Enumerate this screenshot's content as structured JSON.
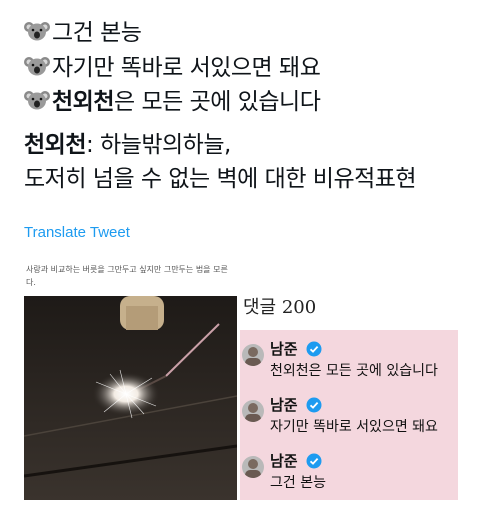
{
  "tweet": {
    "lines": [
      {
        "icon": "koala-emoji",
        "text": "그건 본능"
      },
      {
        "icon": "koala-emoji",
        "text": "자기만 똑바로 서있으면 돼요"
      },
      {
        "icon": "koala-emoji",
        "bold": "천외천",
        "text": "은 모든 곳에 있습니다"
      }
    ],
    "definition": {
      "term": "천외천",
      "line1": ": 하늘밖의하늘,",
      "line2": "도저히 넘을 수 없는 벽에 대한 비유적표현"
    },
    "translate_label": "Translate Tweet"
  },
  "image": {
    "caption": "사랑과 비교하는 버릇을 그만두고 싶지만 그만두는 법을 모른다.",
    "comments_count": "댓글 200",
    "comments": [
      {
        "author": "남준",
        "text": "천외천은 모든 곳에 있습니다"
      },
      {
        "author": "남준",
        "text": "자기만 똑바로 서있으면 돼요"
      },
      {
        "author": "남준",
        "text": "그건 본능"
      }
    ]
  },
  "colors": {
    "link": "#1d9bf0",
    "comments_bg": "#f4d7de",
    "verified": "#1d9bf0"
  }
}
